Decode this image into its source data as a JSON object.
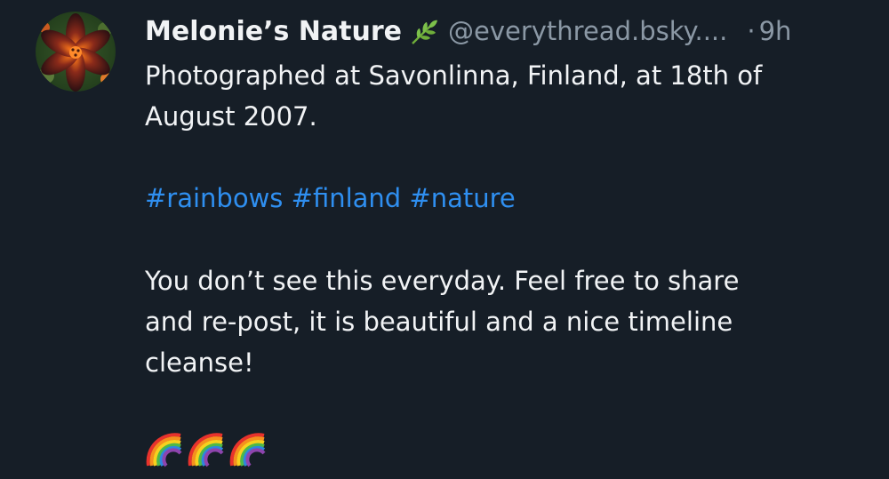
{
  "author": {
    "display_name": "Melonie’s Nature",
    "handle": "@everythread.bsky....",
    "separator": "·",
    "time": "9h",
    "name_icon": "herb-leaf-icon",
    "avatar": "lily-flower-avatar"
  },
  "post": {
    "line1": "Photographed at Savonlinna, Finland, at 18th of",
    "line2": "August 2007.",
    "hashtags": [
      "#rainbows",
      "#finland",
      "#nature"
    ],
    "line4": "You don’t see this everyday.  Feel free to share",
    "line5": "and re-post, it is beautiful and a nice timeline",
    "line6": "cleanse!",
    "emoji": [
      "rainbow-icon",
      "rainbow-icon",
      "rainbow-icon"
    ]
  },
  "colors": {
    "background": "#161e27",
    "text": "#f1f3f5",
    "muted": "#8b98a5",
    "link": "#2f8ff0"
  }
}
